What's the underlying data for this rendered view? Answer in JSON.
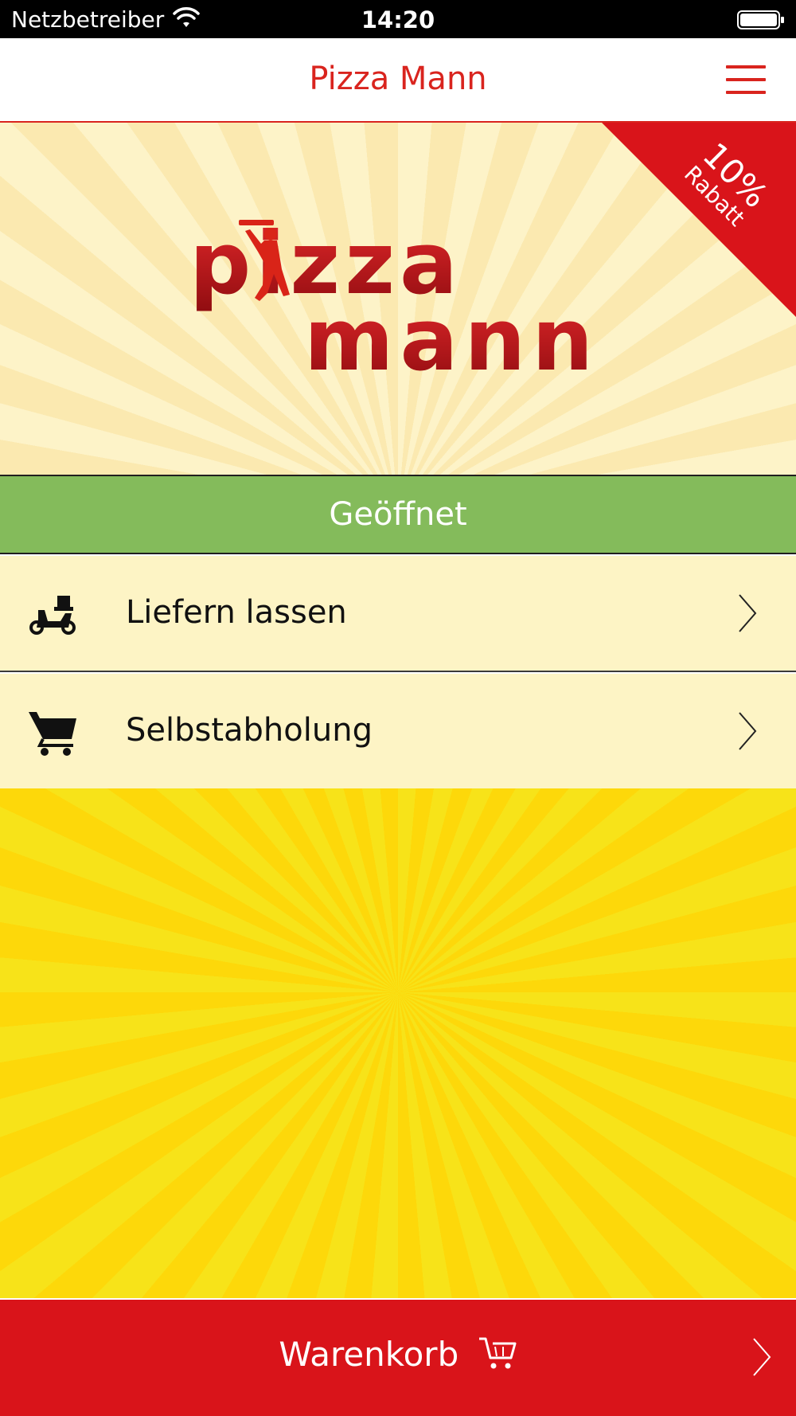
{
  "statusbar": {
    "carrier": "Netzbetreiber",
    "time": "14:20",
    "icons": [
      "wifi-icon",
      "battery-icon"
    ]
  },
  "navbar": {
    "title": "Pizza Mann",
    "menu_icon": "hamburger-menu-icon"
  },
  "hero": {
    "logo_line1": "pizza",
    "logo_line2": "mann",
    "ribbon_percent": "10%",
    "ribbon_label": "Rabatt"
  },
  "status": {
    "label": "Geöffnet",
    "color": "#84bb5b"
  },
  "options": [
    {
      "label": "Liefern lassen",
      "icon": "delivery-scooter-icon"
    },
    {
      "label": "Selbstabholung",
      "icon": "shopping-cart-icon"
    }
  ],
  "cart": {
    "label": "Warenkorb",
    "icon": "cart-outline-icon"
  },
  "colors": {
    "brand_red": "#d9141a",
    "title_red": "#d9241e",
    "row_bg": "#fdf4c5",
    "sun_yellow": "#f7e319"
  }
}
